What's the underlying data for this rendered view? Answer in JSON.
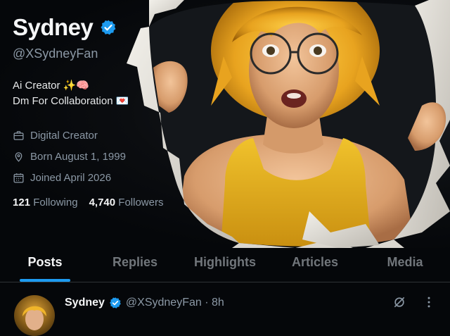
{
  "profile": {
    "name": "Sydney",
    "handle": "@XSydneyFan",
    "bio_line1": "Ai Creator ✨🧠",
    "bio_line2": "Dm For Collaboration 💌",
    "category": "Digital Creator",
    "born": "Born August 1, 1999",
    "joined": "Joined April 2026",
    "following_count": "121",
    "following_label": "Following",
    "followers_count": "4,740",
    "followers_label": "Followers"
  },
  "tabs": [
    {
      "label": "Posts",
      "active": true
    },
    {
      "label": "Replies"
    },
    {
      "label": "Highlights"
    },
    {
      "label": "Articles"
    },
    {
      "label": "Media"
    }
  ],
  "post": {
    "name": "Sydney",
    "handle_time": "@XSydneyFan · 8h"
  },
  "colors": {
    "accent": "#1d9bf0",
    "muted": "#8b98a5",
    "background": "#05070a",
    "hair": "#e8a31f",
    "top": "#e9b92b"
  },
  "icons": {
    "verified": "verified-badge-icon",
    "briefcase": "briefcase-icon",
    "location": "location-pin-icon",
    "calendar": "calendar-icon",
    "grok": "grok-icon",
    "more": "more-options-icon"
  }
}
